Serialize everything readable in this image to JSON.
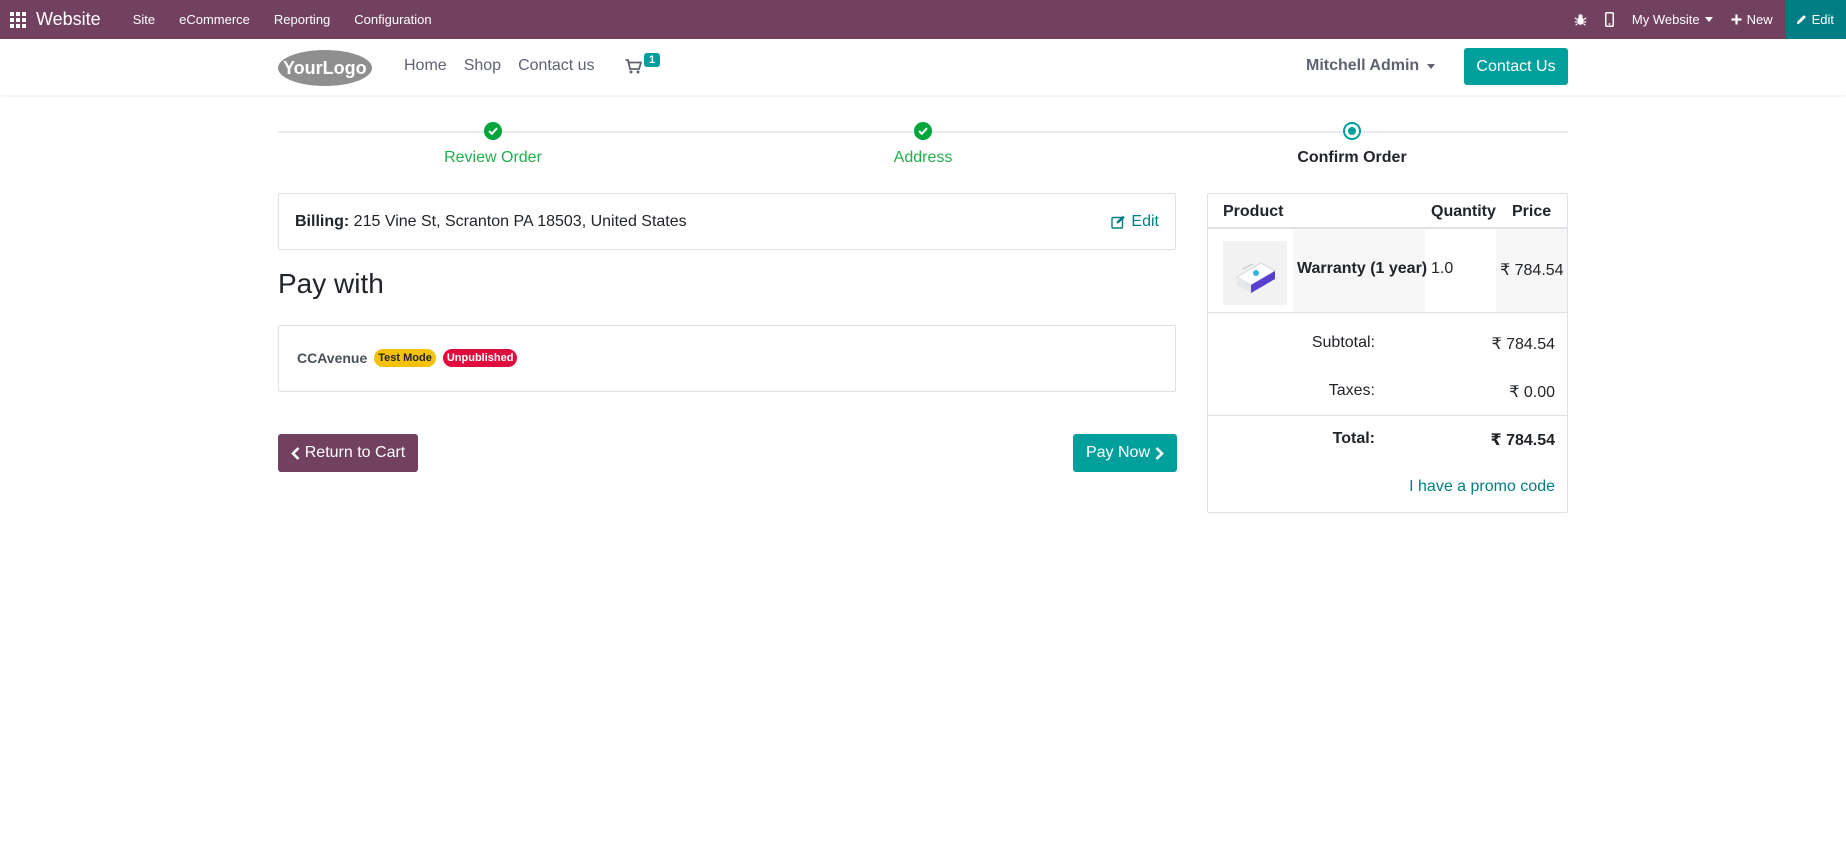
{
  "adminbar": {
    "brand": "Website",
    "menu": [
      "Site",
      "eCommerce",
      "Reporting",
      "Configuration"
    ],
    "website_switcher": "My Website",
    "new_label": "New",
    "edit_label": "Edit"
  },
  "header": {
    "logo_text": "YourLogo",
    "nav": [
      "Home",
      "Shop",
      "Contact us"
    ],
    "cart_count": "1",
    "user": "Mitchell Admin",
    "contact_button": "Contact Us"
  },
  "wizard": {
    "steps": [
      {
        "label": "Review Order",
        "state": "done"
      },
      {
        "label": "Address",
        "state": "done"
      },
      {
        "label": "Confirm Order",
        "state": "current"
      }
    ]
  },
  "billing": {
    "label": "Billing:",
    "address": "215 Vine St, Scranton PA 18503, United States",
    "edit_label": "Edit"
  },
  "payment": {
    "title": "Pay with",
    "provider": "CCAvenue",
    "badges": [
      "Test Mode",
      "Unpublished"
    ]
  },
  "actions": {
    "return_label": "Return to Cart",
    "pay_label": "Pay Now"
  },
  "summary": {
    "columns": [
      "Product",
      "Quantity",
      "Price"
    ],
    "product": {
      "name": "Warranty (1 year)",
      "quantity": "1.0",
      "price": "₹ 784.54"
    },
    "subtotal_label": "Subtotal:",
    "subtotal": "₹ 784.54",
    "taxes_label": "Taxes:",
    "taxes": "₹ 0.00",
    "total_label": "Total:",
    "total": "₹ 784.54",
    "promo_label": "I have a promo code"
  },
  "colors": {
    "adminbar": "#71415f",
    "primary": "#01a09d",
    "success": "#00a53b",
    "link": "#017e84"
  }
}
